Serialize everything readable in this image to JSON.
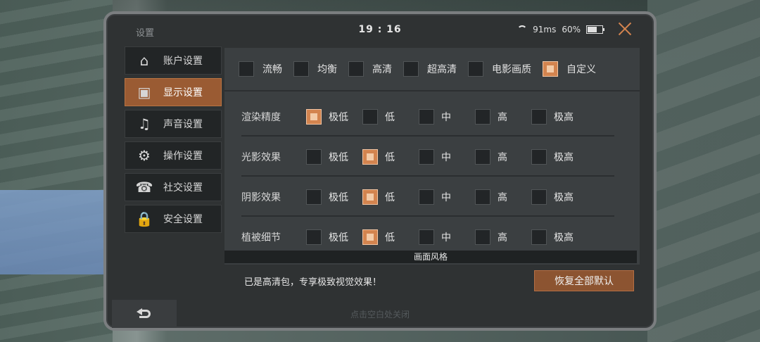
{
  "top": {
    "title": "设置",
    "time": "19 : 16",
    "ping": "91ms",
    "battery": "60%"
  },
  "sidebar": [
    {
      "label": "账户设置",
      "icon": "account-icon",
      "active": false
    },
    {
      "label": "显示设置",
      "icon": "display-icon",
      "active": true
    },
    {
      "label": "声音设置",
      "icon": "sound-icon",
      "active": false
    },
    {
      "label": "操作设置",
      "icon": "controls-icon",
      "active": false
    },
    {
      "label": "社交设置",
      "icon": "social-icon",
      "active": false
    },
    {
      "label": "安全设置",
      "icon": "security-icon",
      "active": false
    }
  ],
  "presets": [
    {
      "label": "流畅",
      "checked": false
    },
    {
      "label": "均衡",
      "checked": false
    },
    {
      "label": "高清",
      "checked": false
    },
    {
      "label": "超高清",
      "checked": false
    },
    {
      "label": "电影画质",
      "checked": false
    },
    {
      "label": "自定义",
      "checked": true
    }
  ],
  "options": [
    "极低",
    "低",
    "中",
    "高",
    "极高"
  ],
  "rows": [
    {
      "label": "渲染精度",
      "selected": 0
    },
    {
      "label": "光影效果",
      "selected": 1
    },
    {
      "label": "阴影效果",
      "selected": 1
    },
    {
      "label": "植被细节",
      "selected": 1
    }
  ],
  "section_title": "画面风格",
  "info_text": "已是高清包，专享极致视觉效果！",
  "reset_label": "恢复全部默认",
  "close_hint": "点击空白处关闭",
  "colors": {
    "accent": "#d3844f",
    "panel": "#2f3233"
  }
}
